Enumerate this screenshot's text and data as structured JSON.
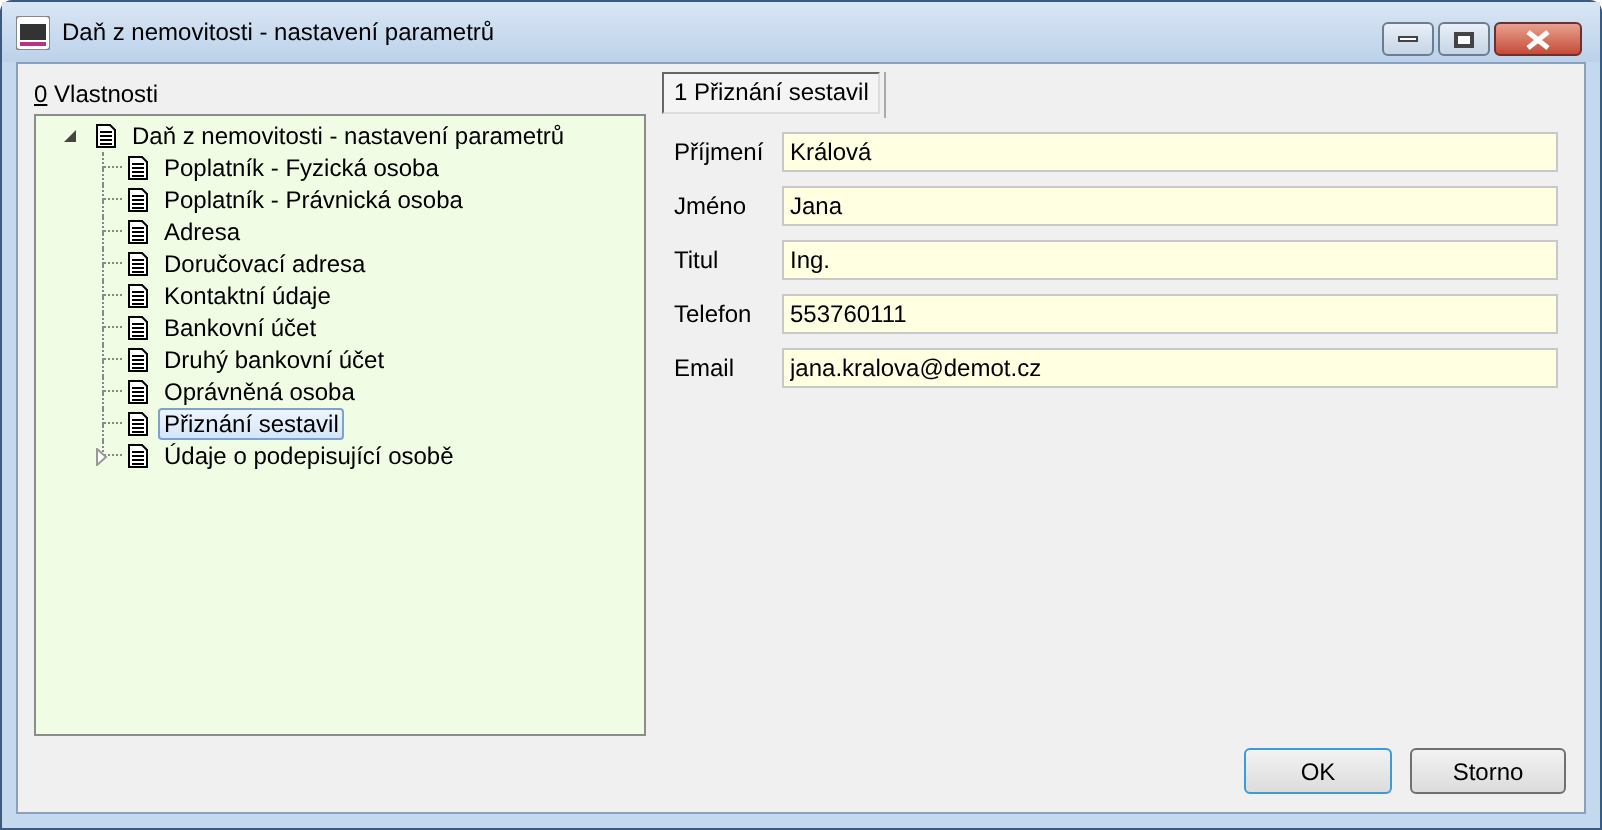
{
  "window": {
    "title": "Daň z nemovitosti - nastavení parametrů"
  },
  "tree_label": "0 Vlastnosti",
  "tree": [
    {
      "label": "Daň z nemovitosti - nastavení parametrů",
      "expanded": true,
      "selected": false,
      "children": [
        {
          "label": "Poplatník - Fyzická osoba",
          "selected": false
        },
        {
          "label": "Poplatník - Právnická osoba",
          "selected": false
        },
        {
          "label": "Adresa",
          "selected": false
        },
        {
          "label": "Doručovací adresa",
          "selected": false
        },
        {
          "label": "Kontaktní údaje",
          "selected": false
        },
        {
          "label": "Bankovní účet",
          "selected": false
        },
        {
          "label": "Druhý bankovní účet",
          "selected": false
        },
        {
          "label": "Oprávněná osoba",
          "selected": false
        },
        {
          "label": "Přiznání sestavil",
          "selected": true
        },
        {
          "label": "Údaje o podepisující osobě",
          "selected": false,
          "expanded": false
        }
      ]
    }
  ],
  "tabs": [
    {
      "label": "1 Přiznání sestavil",
      "selected": true
    }
  ],
  "fields": [
    {
      "label": "Příjmení",
      "value": "Králová"
    },
    {
      "label": "Jméno",
      "value": "Jana"
    },
    {
      "label": "Titul",
      "value": "Ing."
    },
    {
      "label": "Telefon",
      "value": "553760111"
    },
    {
      "label": "Email",
      "value": "jana.kralova@demot.cz"
    }
  ],
  "buttons": [
    {
      "label": "OK",
      "default": true
    },
    {
      "label": "Storno",
      "default": false
    }
  ]
}
